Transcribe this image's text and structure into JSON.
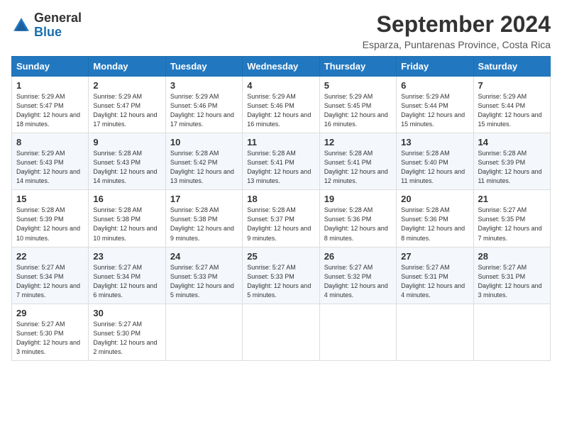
{
  "header": {
    "logo_general": "General",
    "logo_blue": "Blue",
    "month_title": "September 2024",
    "location": "Esparza, Puntarenas Province, Costa Rica"
  },
  "weekdays": [
    "Sunday",
    "Monday",
    "Tuesday",
    "Wednesday",
    "Thursday",
    "Friday",
    "Saturday"
  ],
  "weeks": [
    [
      {
        "day": "1",
        "sunrise": "5:29 AM",
        "sunset": "5:47 PM",
        "daylight": "12 hours and 18 minutes."
      },
      {
        "day": "2",
        "sunrise": "5:29 AM",
        "sunset": "5:47 PM",
        "daylight": "12 hours and 17 minutes."
      },
      {
        "day": "3",
        "sunrise": "5:29 AM",
        "sunset": "5:46 PM",
        "daylight": "12 hours and 17 minutes."
      },
      {
        "day": "4",
        "sunrise": "5:29 AM",
        "sunset": "5:46 PM",
        "daylight": "12 hours and 16 minutes."
      },
      {
        "day": "5",
        "sunrise": "5:29 AM",
        "sunset": "5:45 PM",
        "daylight": "12 hours and 16 minutes."
      },
      {
        "day": "6",
        "sunrise": "5:29 AM",
        "sunset": "5:44 PM",
        "daylight": "12 hours and 15 minutes."
      },
      {
        "day": "7",
        "sunrise": "5:29 AM",
        "sunset": "5:44 PM",
        "daylight": "12 hours and 15 minutes."
      }
    ],
    [
      {
        "day": "8",
        "sunrise": "5:29 AM",
        "sunset": "5:43 PM",
        "daylight": "12 hours and 14 minutes."
      },
      {
        "day": "9",
        "sunrise": "5:28 AM",
        "sunset": "5:43 PM",
        "daylight": "12 hours and 14 minutes."
      },
      {
        "day": "10",
        "sunrise": "5:28 AM",
        "sunset": "5:42 PM",
        "daylight": "12 hours and 13 minutes."
      },
      {
        "day": "11",
        "sunrise": "5:28 AM",
        "sunset": "5:41 PM",
        "daylight": "12 hours and 13 minutes."
      },
      {
        "day": "12",
        "sunrise": "5:28 AM",
        "sunset": "5:41 PM",
        "daylight": "12 hours and 12 minutes."
      },
      {
        "day": "13",
        "sunrise": "5:28 AM",
        "sunset": "5:40 PM",
        "daylight": "12 hours and 11 minutes."
      },
      {
        "day": "14",
        "sunrise": "5:28 AM",
        "sunset": "5:39 PM",
        "daylight": "12 hours and 11 minutes."
      }
    ],
    [
      {
        "day": "15",
        "sunrise": "5:28 AM",
        "sunset": "5:39 PM",
        "daylight": "12 hours and 10 minutes."
      },
      {
        "day": "16",
        "sunrise": "5:28 AM",
        "sunset": "5:38 PM",
        "daylight": "12 hours and 10 minutes."
      },
      {
        "day": "17",
        "sunrise": "5:28 AM",
        "sunset": "5:38 PM",
        "daylight": "12 hours and 9 minutes."
      },
      {
        "day": "18",
        "sunrise": "5:28 AM",
        "sunset": "5:37 PM",
        "daylight": "12 hours and 9 minutes."
      },
      {
        "day": "19",
        "sunrise": "5:28 AM",
        "sunset": "5:36 PM",
        "daylight": "12 hours and 8 minutes."
      },
      {
        "day": "20",
        "sunrise": "5:28 AM",
        "sunset": "5:36 PM",
        "daylight": "12 hours and 8 minutes."
      },
      {
        "day": "21",
        "sunrise": "5:27 AM",
        "sunset": "5:35 PM",
        "daylight": "12 hours and 7 minutes."
      }
    ],
    [
      {
        "day": "22",
        "sunrise": "5:27 AM",
        "sunset": "5:34 PM",
        "daylight": "12 hours and 7 minutes."
      },
      {
        "day": "23",
        "sunrise": "5:27 AM",
        "sunset": "5:34 PM",
        "daylight": "12 hours and 6 minutes."
      },
      {
        "day": "24",
        "sunrise": "5:27 AM",
        "sunset": "5:33 PM",
        "daylight": "12 hours and 5 minutes."
      },
      {
        "day": "25",
        "sunrise": "5:27 AM",
        "sunset": "5:33 PM",
        "daylight": "12 hours and 5 minutes."
      },
      {
        "day": "26",
        "sunrise": "5:27 AM",
        "sunset": "5:32 PM",
        "daylight": "12 hours and 4 minutes."
      },
      {
        "day": "27",
        "sunrise": "5:27 AM",
        "sunset": "5:31 PM",
        "daylight": "12 hours and 4 minutes."
      },
      {
        "day": "28",
        "sunrise": "5:27 AM",
        "sunset": "5:31 PM",
        "daylight": "12 hours and 3 minutes."
      }
    ],
    [
      {
        "day": "29",
        "sunrise": "5:27 AM",
        "sunset": "5:30 PM",
        "daylight": "12 hours and 3 minutes."
      },
      {
        "day": "30",
        "sunrise": "5:27 AM",
        "sunset": "5:30 PM",
        "daylight": "12 hours and 2 minutes."
      },
      null,
      null,
      null,
      null,
      null
    ]
  ],
  "labels": {
    "sunrise": "Sunrise:",
    "sunset": "Sunset:",
    "daylight": "Daylight:"
  }
}
